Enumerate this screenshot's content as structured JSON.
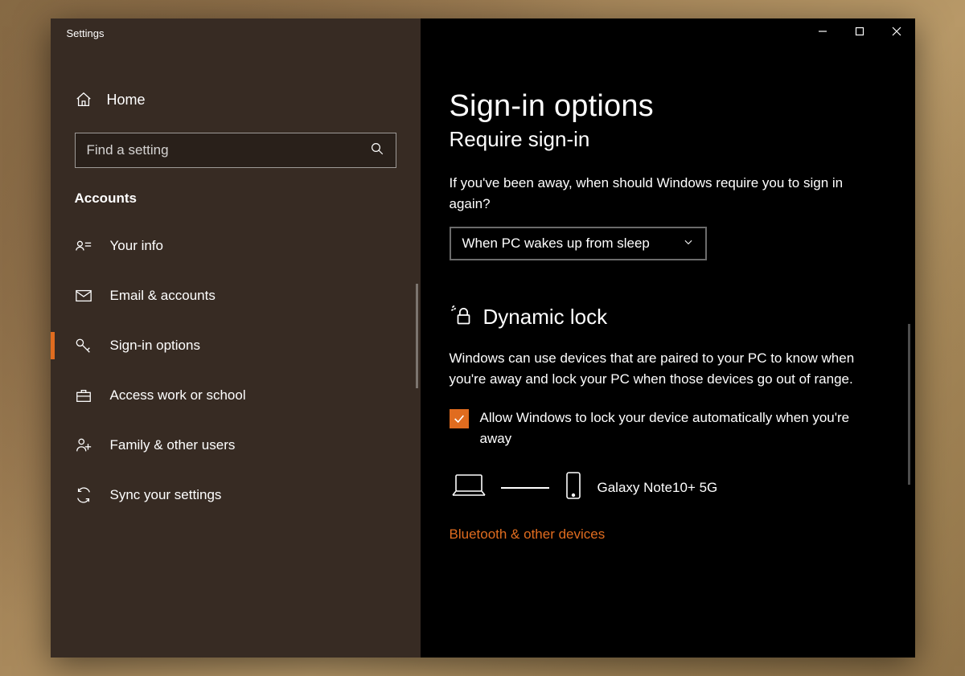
{
  "window": {
    "title": "Settings"
  },
  "sidebar": {
    "home": "Home",
    "search_placeholder": "Find a setting",
    "group": "Accounts",
    "items": [
      {
        "label": "Your info"
      },
      {
        "label": "Email & accounts"
      },
      {
        "label": "Sign-in options"
      },
      {
        "label": "Access work or school"
      },
      {
        "label": "Family & other users"
      },
      {
        "label": "Sync your settings"
      }
    ]
  },
  "main": {
    "title": "Sign-in options",
    "require": {
      "heading": "Require sign-in",
      "desc": "If you've been away, when should Windows require you to sign in again?",
      "value": "When PC wakes up from sleep"
    },
    "dynamic": {
      "heading": "Dynamic lock",
      "desc": "Windows can use devices that are paired to your PC to know when you're away and lock your PC when those devices go out of range.",
      "checkbox_label": "Allow Windows to lock your device automatically when you're away",
      "paired_device": "Galaxy Note10+ 5G",
      "link": "Bluetooth & other devices"
    }
  }
}
